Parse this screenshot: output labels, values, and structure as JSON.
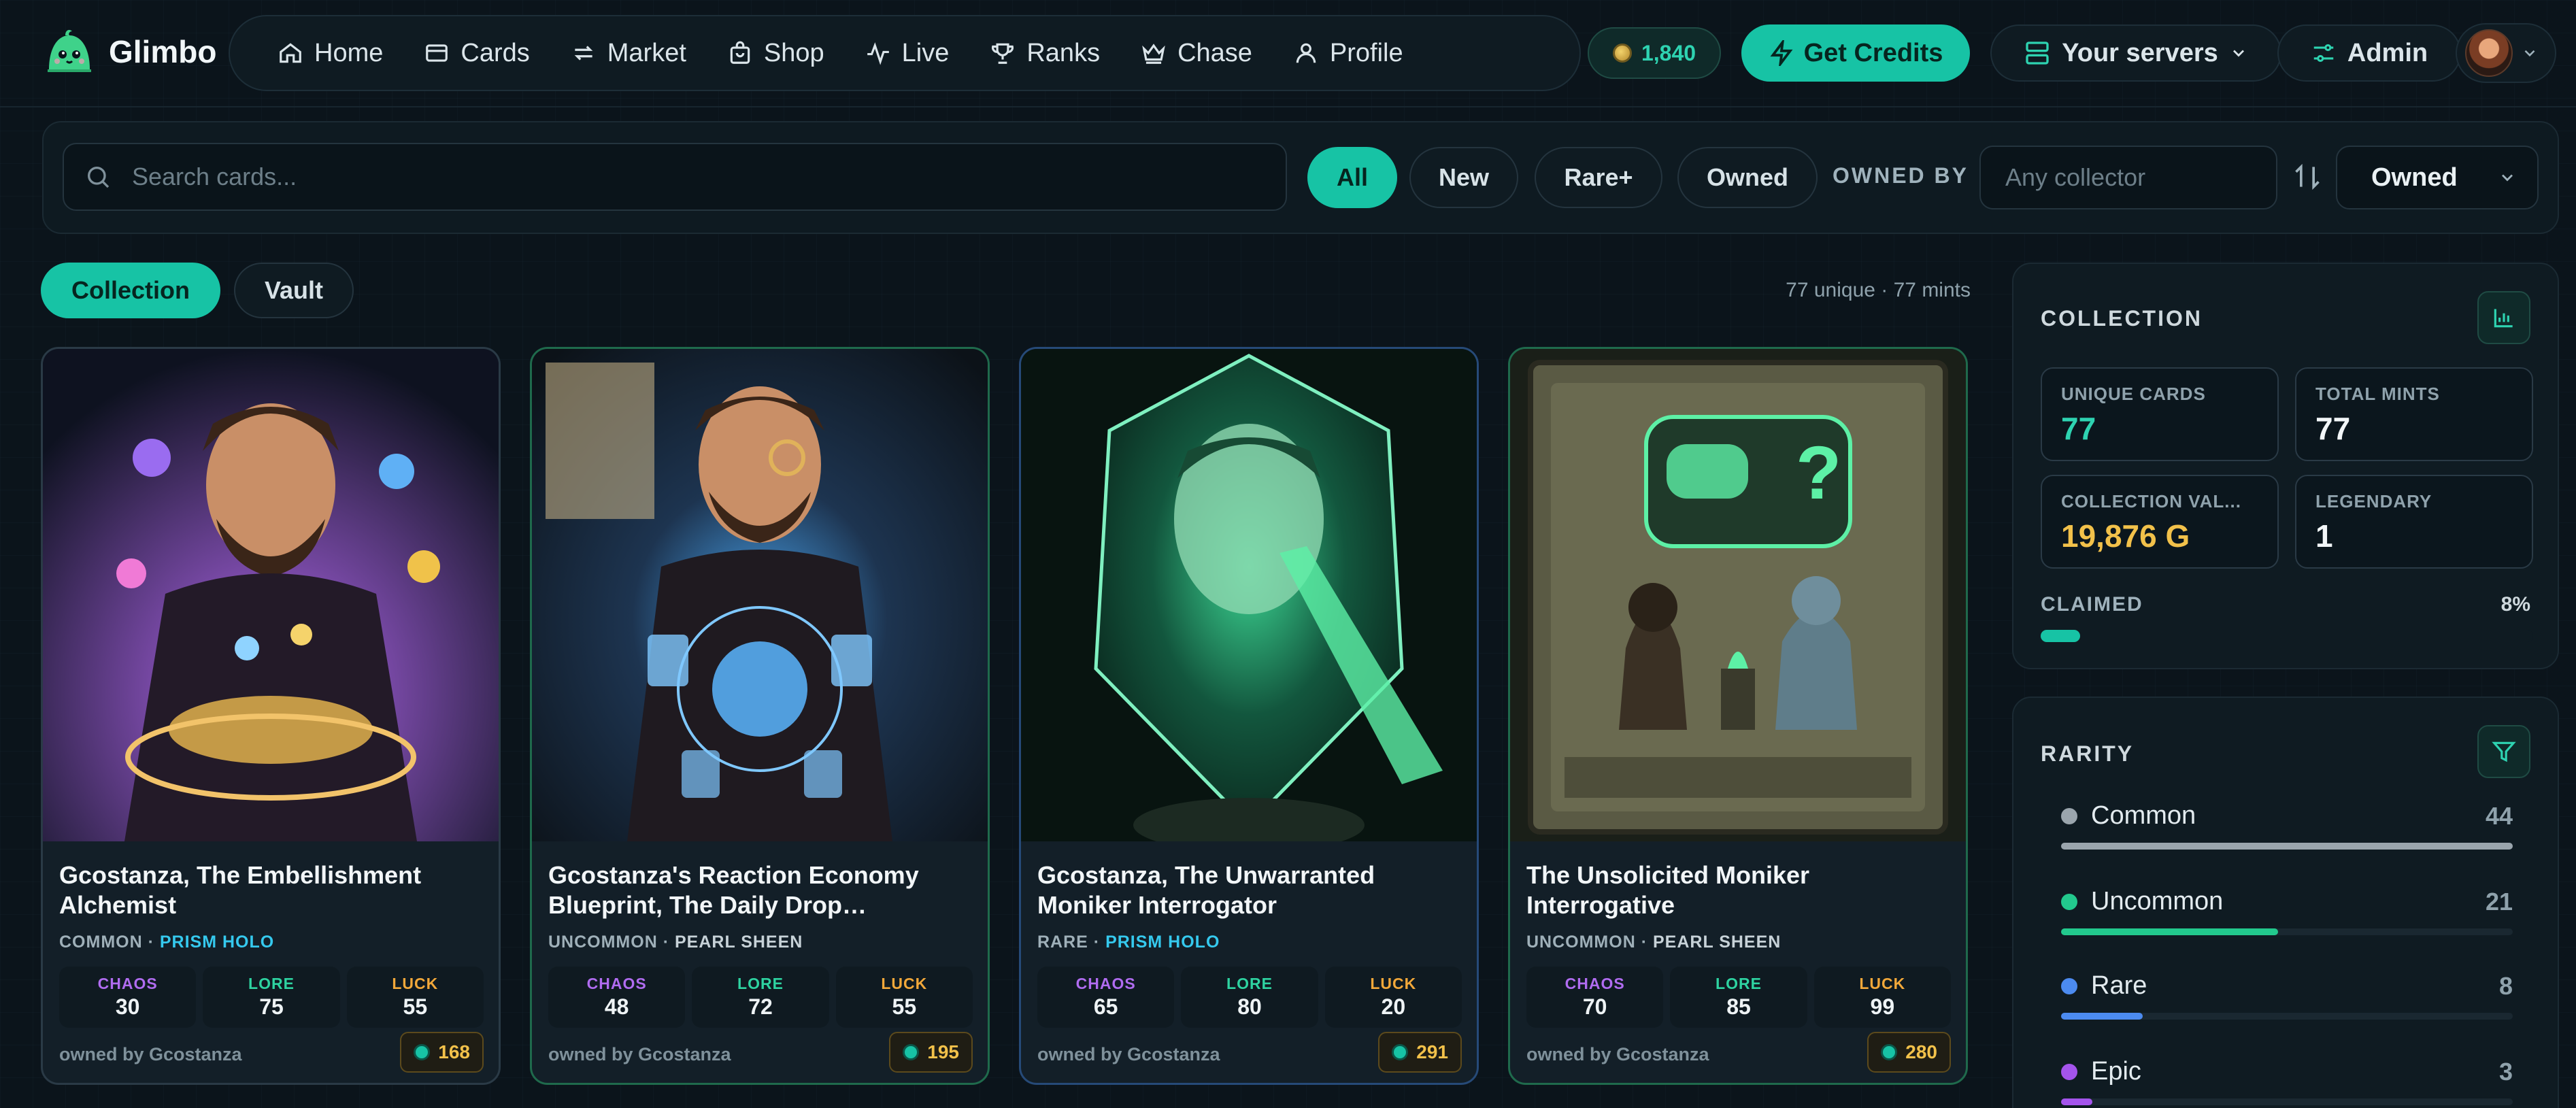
{
  "brand": {
    "name": "Glimbo"
  },
  "nav": {
    "items": [
      {
        "label": "Home",
        "icon": "home-icon"
      },
      {
        "label": "Cards",
        "icon": "card-icon"
      },
      {
        "label": "Market",
        "icon": "swap-icon"
      },
      {
        "label": "Shop",
        "icon": "bag-icon"
      },
      {
        "label": "Live",
        "icon": "pulse-icon"
      },
      {
        "label": "Ranks",
        "icon": "trophy-icon"
      },
      {
        "label": "Chase",
        "icon": "crown-icon"
      },
      {
        "label": "Profile",
        "icon": "user-icon"
      }
    ],
    "balance": "1,840",
    "get_credits": "Get Credits",
    "servers": "Your servers",
    "admin": "Admin"
  },
  "filters": {
    "search_placeholder": "Search cards...",
    "chips": [
      "All",
      "New",
      "Rare+",
      "Owned"
    ],
    "active_chip": "All",
    "owned_by_label": "OWNED BY",
    "collector_placeholder": "Any collector",
    "sort_value": "Owned"
  },
  "views": {
    "tabs": [
      "Collection",
      "Vault"
    ],
    "active": "Collection",
    "summary": "77 unique · 77 mints"
  },
  "cards": [
    {
      "title": "Gcostanza, The Embellishment Alchemist",
      "rarity": "COMMON",
      "finish": "PRISM HOLO",
      "chaos": "30",
      "lore": "75",
      "luck": "55",
      "owner": "owned by Gcostanza",
      "price": "168"
    },
    {
      "title": "Gcostanza's Reaction Economy Blueprint, The Daily Drop…",
      "rarity": "UNCOMMON",
      "finish": "PEARL SHEEN",
      "chaos": "48",
      "lore": "72",
      "luck": "55",
      "owner": "owned by Gcostanza",
      "price": "195"
    },
    {
      "title": "Gcostanza, The Unwarranted Moniker Interrogator",
      "rarity": "RARE",
      "finish": "PRISM HOLO",
      "chaos": "65",
      "lore": "80",
      "luck": "20",
      "owner": "owned by Gcostanza",
      "price": "291"
    },
    {
      "title": "The Unsolicited Moniker Interrogative",
      "rarity": "UNCOMMON",
      "finish": "PEARL SHEEN",
      "chaos": "70",
      "lore": "85",
      "luck": "99",
      "owner": "owned by Gcostanza",
      "price": "280"
    }
  ],
  "stat_labels": {
    "chaos": "CHAOS",
    "lore": "LORE",
    "luck": "LUCK"
  },
  "collection": {
    "title": "COLLECTION",
    "unique_label": "UNIQUE CARDS",
    "unique_value": "77",
    "mints_label": "TOTAL MINTS",
    "mints_value": "77",
    "value_label": "COLLECTION VAL...",
    "value_value": "19,876 G",
    "legendary_label": "LEGENDARY",
    "legendary_value": "1",
    "claimed_label": "CLAIMED",
    "claimed_pct": "8%",
    "claimed_fraction": 0.08
  },
  "rarity": {
    "title": "RARITY",
    "rows": [
      {
        "name": "Common",
        "count": "44",
        "color": "#9aa5ad",
        "fraction": 1.0
      },
      {
        "name": "Uncommon",
        "count": "21",
        "color": "#22c98d",
        "fraction": 0.48
      },
      {
        "name": "Rare",
        "count": "8",
        "color": "#4c8bf0",
        "fraction": 0.18
      },
      {
        "name": "Epic",
        "count": "3",
        "color": "#a454ec",
        "fraction": 0.07
      }
    ]
  },
  "colors": {
    "accent": "#17c3a5",
    "gold": "#f2c14a",
    "background": "#0b141b"
  }
}
